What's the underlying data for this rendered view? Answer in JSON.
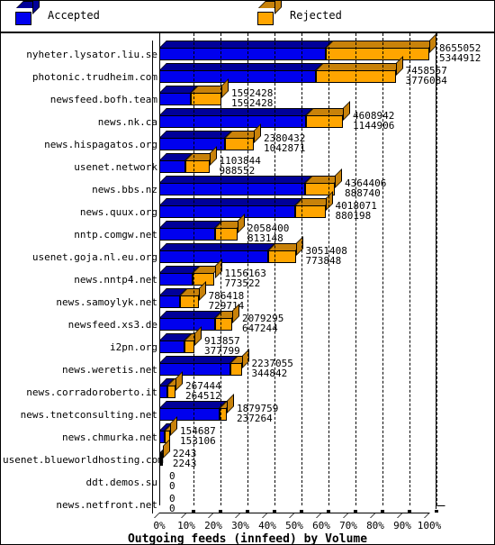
{
  "legend": {
    "items": [
      {
        "label": "Accepted",
        "color": "#0000ee",
        "icon": "cube-icon"
      },
      {
        "label": "Rejected",
        "color": "#ffa500",
        "icon": "cube-icon"
      }
    ]
  },
  "chart_data": {
    "type": "bar",
    "subtype": "horizontal-stacked-100-percent-3d",
    "title": "Outgoing feeds (innfeed) by Volume",
    "xlabel": "Outgoing feeds (innfeed) by Volume",
    "ylabel": "",
    "xlim": [
      0,
      100
    ],
    "xtick_labels": [
      "0%",
      "10%",
      "20%",
      "30%",
      "40%",
      "50%",
      "60%",
      "70%",
      "80%",
      "90%",
      "100%"
    ],
    "xtick_values": [
      0,
      10,
      20,
      30,
      40,
      50,
      60,
      70,
      80,
      90,
      100
    ],
    "grid": true,
    "grid_style": "dashed-vertical",
    "legend_position": "top",
    "categories": [
      "nyheter.lysator.liu.se",
      "photonic.trudheim.com",
      "newsfeed.bofh.team",
      "news.nk.ca",
      "news.hispagatos.org",
      "usenet.network",
      "news.bbs.nz",
      "news.quux.org",
      "nntp.comgw.net",
      "usenet.goja.nl.eu.org",
      "news.nntp4.net",
      "news.samoylyk.net",
      "newsfeed.xs3.de",
      "i2pn.org",
      "news.weretis.net",
      "news.corradoroberto.it",
      "news.tnetconsulting.net",
      "news.chmurka.net",
      "usenet.blueworldhosting.com",
      "ddt.demos.su",
      "news.netfront.net"
    ],
    "series": [
      {
        "name": "Accepted",
        "color": "#0000ee",
        "values": [
          8655052,
          7458557,
          1592428,
          4608942,
          2380432,
          1103844,
          4364406,
          4018071,
          2058400,
          3051408,
          1156163,
          786418,
          2079295,
          913857,
          2237055,
          267444,
          1879759,
          154687,
          2243,
          0,
          0
        ]
      },
      {
        "name": "Rejected",
        "color": "#ffa500",
        "values": [
          5344912,
          3776084,
          1592428,
          1144906,
          1042871,
          988552,
          888740,
          880198,
          813148,
          773848,
          773522,
          729714,
          647244,
          377799,
          344842,
          264512,
          237264,
          153106,
          2243,
          0,
          0
        ]
      }
    ],
    "row_total_widths_percent": [
      100.0,
      87.5,
      23.0,
      68.0,
      35.0,
      18.5,
      65.0,
      61.5,
      29.0,
      50.5,
      20.5,
      14.5,
      27.0,
      13.0,
      30.5,
      6.0,
      25.0,
      4.0,
      1.3,
      0,
      0
    ],
    "row_accepted_fraction": [
      0.618,
      0.664,
      0.5,
      0.801,
      0.695,
      0.527,
      0.831,
      0.82,
      0.717,
      0.798,
      0.599,
      0.519,
      0.763,
      0.708,
      0.867,
      0.503,
      0.888,
      0.503,
      0.5,
      0,
      0
    ],
    "value_label_pairs": [
      [
        "8655052",
        "5344912"
      ],
      [
        "7458557",
        "3776084"
      ],
      [
        "1592428",
        "1592428"
      ],
      [
        "4608942",
        "1144906"
      ],
      [
        "2380432",
        "1042871"
      ],
      [
        "1103844",
        "988552"
      ],
      [
        "4364406",
        "888740"
      ],
      [
        "4018071",
        "880198"
      ],
      [
        "2058400",
        "813148"
      ],
      [
        "3051408",
        "773848"
      ],
      [
        "1156163",
        "773522"
      ],
      [
        "786418",
        "729714"
      ],
      [
        "2079295",
        "647244"
      ],
      [
        "913857",
        "377799"
      ],
      [
        "2237055",
        "344842"
      ],
      [
        "267444",
        "264512"
      ],
      [
        "1879759",
        "237264"
      ],
      [
        "154687",
        "153106"
      ],
      [
        "2243",
        "2243"
      ],
      [
        "0",
        "0"
      ],
      [
        "0",
        "0"
      ]
    ]
  }
}
